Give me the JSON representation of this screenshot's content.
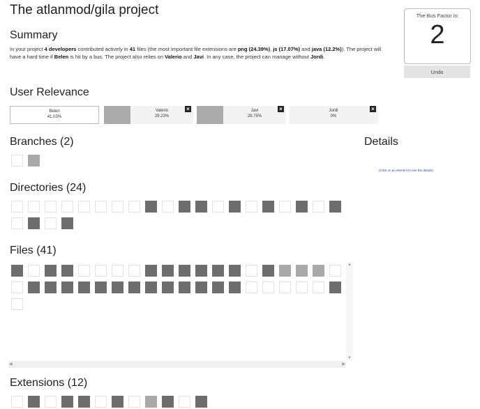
{
  "title": "The atlanmod/gila project",
  "summary": {
    "heading": "Summary",
    "p1": "In your project ",
    "devs": "4 developers",
    "p2": " contributed actively in ",
    "files": "41",
    "p3": " files (the most important file extensions are ",
    "ext1": "png (24.39%)",
    "sep1": ", ",
    "ext2": "js (17.07%)",
    "and": " and ",
    "ext3": "java (12.2%)",
    "p4": "). The project will have a hard time if ",
    "name1": "Belen",
    "p5": " is hit by a bus. The project also relies on ",
    "name2": "Valerio",
    "p6": " and ",
    "name3": "Javi",
    "p7": ". In any case, the project can manage without ",
    "name4": "Jordi",
    "p8": "."
  },
  "bus_factor": {
    "label": "The Bus Factor is:",
    "value": "2",
    "undo_label": "Undo"
  },
  "user_relevance": {
    "heading": "User Relevance",
    "users": [
      {
        "name": "Belen",
        "percent": "41.03%",
        "selected": true
      },
      {
        "name": "Valerio",
        "percent": "29.23%",
        "selected": false
      },
      {
        "name": "Javi",
        "percent": "28.75%",
        "selected": false
      },
      {
        "name": "Jordi",
        "percent": "0%",
        "selected": false
      }
    ],
    "remove_icon": "×"
  },
  "branches": {
    "heading": "Branches (2)",
    "cells": [
      "w",
      "m"
    ]
  },
  "details": {
    "heading": "Details",
    "hint": "(Click on an element to see the details)"
  },
  "directories": {
    "heading": "Directories (24)",
    "cells": [
      "w",
      "w",
      "w",
      "w",
      "w",
      "w",
      "w",
      "w",
      "d",
      "w",
      "d",
      "d",
      "w",
      "d",
      "w",
      "d",
      "w",
      "d",
      "w",
      "d",
      "w",
      "d",
      "w",
      "d"
    ]
  },
  "files": {
    "heading": "Files (41)",
    "cells": [
      "d",
      "w",
      "d",
      "d",
      "w",
      "w",
      "w",
      "w",
      "d",
      "d",
      "d",
      "d",
      "d",
      "d",
      "w",
      "d",
      "m",
      "m",
      "m",
      "w",
      "w",
      "d",
      "d",
      "d",
      "d",
      "d",
      "d",
      "d",
      "d",
      "d",
      "d",
      "d",
      "d",
      "d",
      "w",
      "w",
      "w",
      "w",
      "w",
      "d",
      "w"
    ]
  },
  "extensions": {
    "heading": "Extensions (12)",
    "cells": [
      "w",
      "d",
      "w",
      "d",
      "d",
      "w",
      "d",
      "w",
      "m",
      "d",
      "w",
      "d"
    ]
  }
}
